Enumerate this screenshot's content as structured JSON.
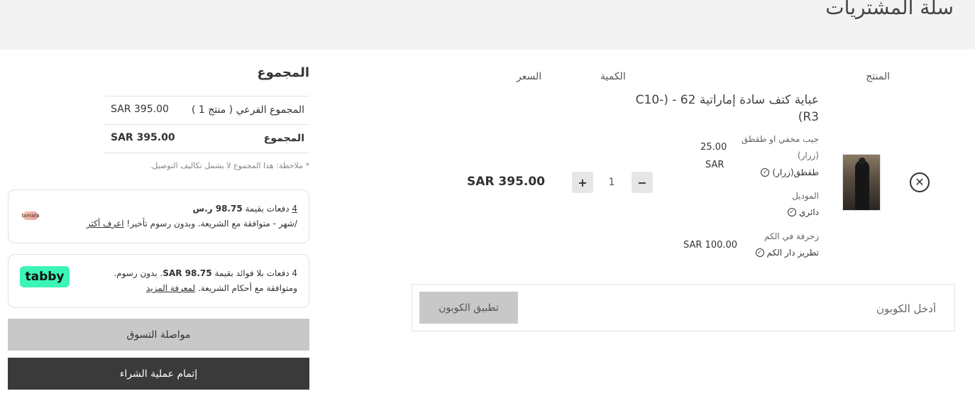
{
  "header": {
    "title": "سلة المشتريات"
  },
  "cart_table": {
    "columns": {
      "product": "المنتج",
      "quantity": "الكمية",
      "price": "السعر"
    }
  },
  "item": {
    "name": "عباية كتف سادة إماراتية 62 - (C10-R3)",
    "options": [
      {
        "label": "جيب مخفي او طقطق",
        "label2": "(زرار)",
        "value": "طقطق(زرار)",
        "price": "25.00",
        "currency": "SAR"
      },
      {
        "label": "الموديل",
        "value": "دائري"
      },
      {
        "label": "زخرفة في الكم",
        "value": "تطريز دار الكم",
        "price": "SAR 100.00"
      }
    ],
    "quantity": "1",
    "price": "SAR 395.00"
  },
  "coupon": {
    "placeholder": "أدخل الكوبون",
    "button": "تطبيق الكوبون"
  },
  "totals": {
    "title": "المجموع",
    "subtotal_label": "المجموع الفرعي ( منتج 1 )",
    "subtotal_value": "SAR 395.00",
    "total_label": "المجموع",
    "total_value": "SAR 395.00",
    "note": "* ملاحظة: هذا المجموع لا يشمل تكاليف التوصيل."
  },
  "tamara": {
    "count": "4",
    "line1_mid": " دفعات بقيمة ",
    "amount": "98.75 ر.س",
    "line2": "/شهر - متوافقة مع الشريعة. وبدون رسوم تأخير! ",
    "link": "اعرف أكثر",
    "logo": "tamara"
  },
  "tabby": {
    "line1_pre": "4 دفعات بلا فوائد بقيمة ",
    "amount": "SAR 98.75",
    "line1_post": ". بدون رسوم.",
    "line2": "ومتوافقة مع أحكام الشريعة. ",
    "link": "لمعرفة المزيد",
    "logo": "tabby"
  },
  "buttons": {
    "continue": "مواصلة التسوق",
    "checkout": "إتمام عملية الشراء"
  },
  "colors": {
    "header_bg": "#f3f3f3",
    "checkout_bg": "#3a3a3a",
    "tabby_green": "#3bf5b5",
    "muted_button": "#c8c8c8"
  },
  "icons": {
    "remove": "close-circle-icon",
    "check": "check-circle-icon",
    "minus": "minus-icon",
    "plus": "plus-icon"
  }
}
